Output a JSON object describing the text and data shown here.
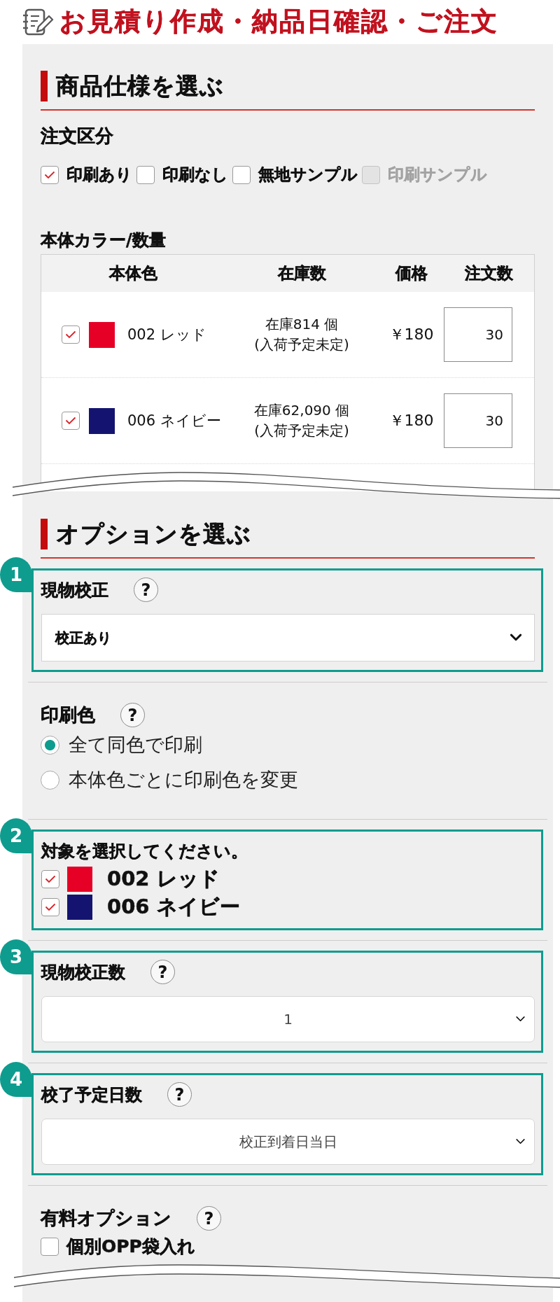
{
  "header": {
    "title": "お見積り作成・納品日確認・ご注文"
  },
  "product_spec": {
    "heading": "商品仕様を選ぶ",
    "order_type": {
      "label": "注文区分",
      "options": [
        {
          "label": "印刷あり",
          "checked": true,
          "disabled": false
        },
        {
          "label": "印刷なし",
          "checked": false,
          "disabled": false
        },
        {
          "label": "無地サンプル",
          "checked": false,
          "disabled": false
        },
        {
          "label": "印刷サンプル",
          "checked": false,
          "disabled": true
        }
      ]
    },
    "color_quantity": {
      "label": "本体カラー/数量",
      "columns": [
        "本体色",
        "在庫数",
        "価格",
        "注文数"
      ],
      "rows": [
        {
          "checked": true,
          "color": "#e60026",
          "name": "002 レッド",
          "stock": "在庫814 個",
          "arrival": "(入荷予定未定)",
          "price": "￥180",
          "quantity": "30"
        },
        {
          "checked": true,
          "color": "#141470",
          "name": "006 ネイビー",
          "stock": "在庫62,090 個",
          "arrival": "(入荷予定未定)",
          "price": "￥180",
          "quantity": "30"
        }
      ]
    }
  },
  "options": {
    "heading": "オプションを選ぶ",
    "items": [
      {
        "kind": "select",
        "badge": "1",
        "label": "現物校正",
        "help": "?",
        "value": "校正あり"
      },
      {
        "kind": "radio",
        "label": "印刷色",
        "help": "?",
        "options": [
          {
            "label": "全て同色で印刷",
            "selected": true
          },
          {
            "label": "本体色ごとに印刷色を変更",
            "selected": false
          }
        ]
      },
      {
        "kind": "color_checklist",
        "badge": "2",
        "label": "対象を選択してください。",
        "options": [
          {
            "checked": true,
            "color": "#e60026",
            "label": "002 レッド"
          },
          {
            "checked": true,
            "color": "#141470",
            "label": "006 ネイビー"
          }
        ]
      },
      {
        "kind": "centered_select",
        "badge": "3",
        "label": "現物校正数",
        "help": "?",
        "value": "1"
      },
      {
        "kind": "centered_select",
        "badge": "4",
        "label": "校了予定日数",
        "help": "?",
        "value": "校正到着日当日"
      },
      {
        "kind": "checklist",
        "label": "有料オプション",
        "help": "?",
        "options": [
          {
            "label": "個別OPP袋入れ",
            "checked": false
          }
        ]
      }
    ]
  }
}
